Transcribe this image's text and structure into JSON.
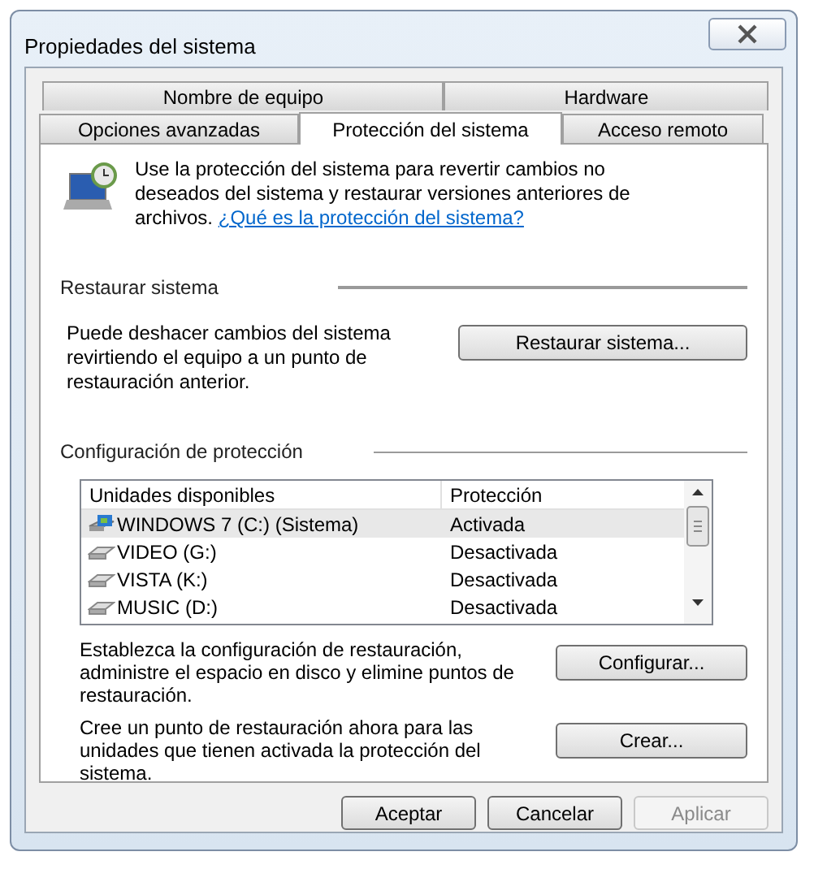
{
  "window": {
    "title": "Propiedades del sistema"
  },
  "tab_rows": [
    [
      {
        "label": "Nombre de equipo",
        "selected": false
      },
      {
        "label": "Hardware",
        "selected": false
      }
    ],
    [
      {
        "label": "Opciones avanzadas",
        "selected": false
      },
      {
        "label": "Protección del sistema",
        "selected": true
      },
      {
        "label": "Acceso remoto",
        "selected": false
      }
    ]
  ],
  "intro": {
    "text": "Use la protección del sistema para revertir cambios no deseados del sistema y restaurar versiones anteriores de archivos.",
    "link": "¿Qué es la protección del sistema?"
  },
  "restore_group": {
    "title": "Restaurar sistema",
    "text": "Puede deshacer cambios del sistema revirtiendo el equipo a un punto de restauración anterior.",
    "button": "Restaurar sistema..."
  },
  "protection_group": {
    "title": "Configuración de protección",
    "columns": [
      "Unidades disponibles",
      "Protección"
    ],
    "drives": [
      {
        "kind": "system",
        "name": "WINDOWS 7 (C:) (Sistema)",
        "protection": "Activada",
        "selected": true
      },
      {
        "kind": "drive",
        "name": "VIDEO (G:)",
        "protection": "Desactivada",
        "selected": false
      },
      {
        "kind": "drive",
        "name": "VISTA (K:)",
        "protection": "Desactivada",
        "selected": false
      },
      {
        "kind": "drive",
        "name": "MUSIC (D:)",
        "protection": "Desactivada",
        "selected": false
      }
    ],
    "actions": [
      {
        "text": "Establezca la configuración de restauración, administre el espacio en disco y elimine puntos de restauración.",
        "button": "Configurar..."
      },
      {
        "text": "Cree un punto de restauración ahora para las unidades que tienen activada la protección del sistema.",
        "button": "Crear..."
      }
    ]
  },
  "buttons": [
    {
      "label": "Aceptar",
      "disabled": false
    },
    {
      "label": "Cancelar",
      "disabled": false
    },
    {
      "label": "Aplicar",
      "disabled": true
    }
  ]
}
